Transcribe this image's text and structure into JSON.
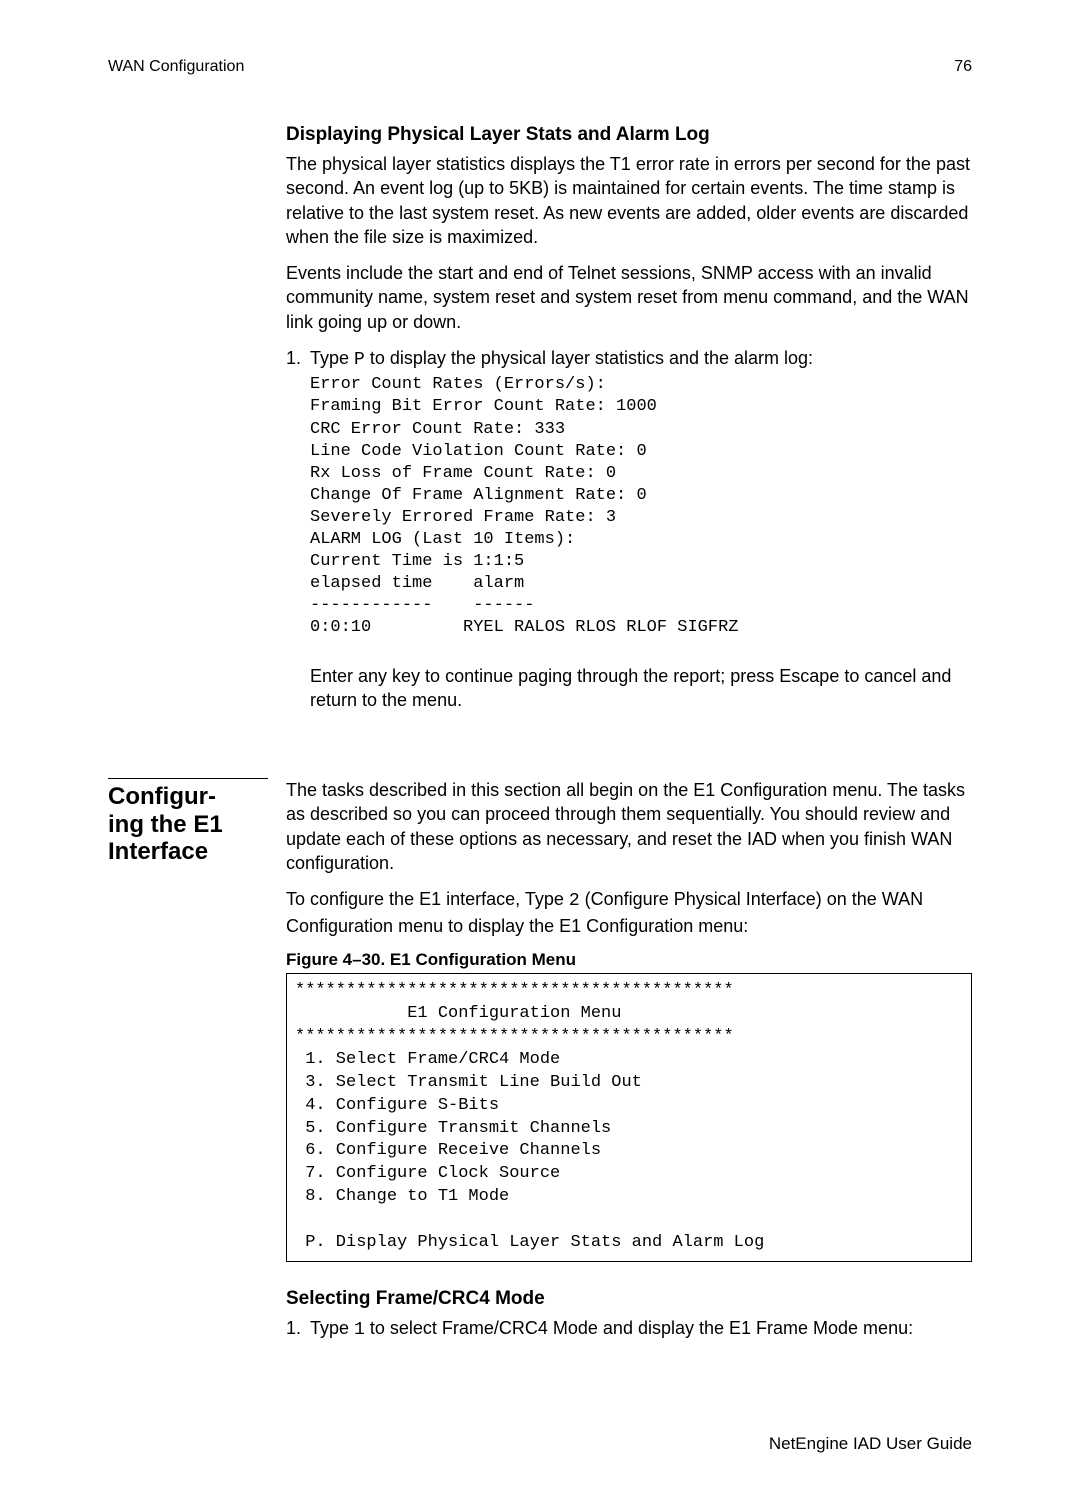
{
  "header": {
    "left": "WAN Configuration",
    "right": "76"
  },
  "sect1": {
    "title": "Displaying Physical Layer Stats and Alarm Log",
    "p1": "The physical layer statistics displays the T1 error rate in errors per second for the past second. An event log (up to 5KB) is maintained for certain events. The time stamp is relative to the last system reset. As new events are added, older events are discarded when the file size is maximized.",
    "p2": "Events include the start and end of Telnet sessions, SNMP access with an invalid community name, system reset and system reset from menu command, and the WAN link going up or down.",
    "step_num": "1.",
    "step_pre": "Type ",
    "step_code": "P",
    "step_post": " to display the physical layer statistics and the alarm log:",
    "code": "Error Count Rates (Errors/s):\nFraming Bit Error Count Rate: 1000\nCRC Error Count Rate: 333\nLine Code Violation Count Rate: 0\nRx Loss of Frame Count Rate: 0\nChange Of Frame Alignment Rate: 0\nSeverely Errored Frame Rate: 3\nALARM LOG (Last 10 Items):\nCurrent Time is 1:1:5\nelapsed time    alarm\n------------    ------\n0:0:10         RYEL RALOS RLOS RLOF SIGFRZ",
    "p3": "Enter any key to continue paging through the report; press Escape to cancel and return to the menu."
  },
  "sect2": {
    "side_heading": "Configur-\ning the E1\nInterface",
    "p1": "The tasks described in this section all begin on the E1 Configuration menu. The tasks as described so you can proceed through them sequentially. You should review and update each of these options as necessary, and reset the IAD when you finish WAN configuration.",
    "p2_pre": "To configure the E1 interface, Type ",
    "p2_code": "2",
    "p2_post": " (Configure Physical Interface) on the WAN Configuration menu to display the E1 Configuration menu:",
    "fig_caption": "Figure 4–30.  E1 Configuration Menu",
    "fig_body": "*******************************************\n           E1 Configuration Menu\n*******************************************\n 1. Select Frame/CRC4 Mode\n 3. Select Transmit Line Build Out\n 4. Configure S-Bits\n 5. Configure Transmit Channels\n 6. Configure Receive Channels\n 7. Configure Clock Source\n 8. Change to T1 Mode\n\n P. Display Physical Layer Stats and Alarm Log",
    "sub2": "Selecting Frame/CRC4 Mode",
    "step_num": "1.",
    "step_pre": "Type ",
    "step_code": "1",
    "step_post": " to select Frame/CRC4 Mode and display the E1 Frame Mode menu:"
  },
  "footer": "NetEngine IAD User Guide"
}
